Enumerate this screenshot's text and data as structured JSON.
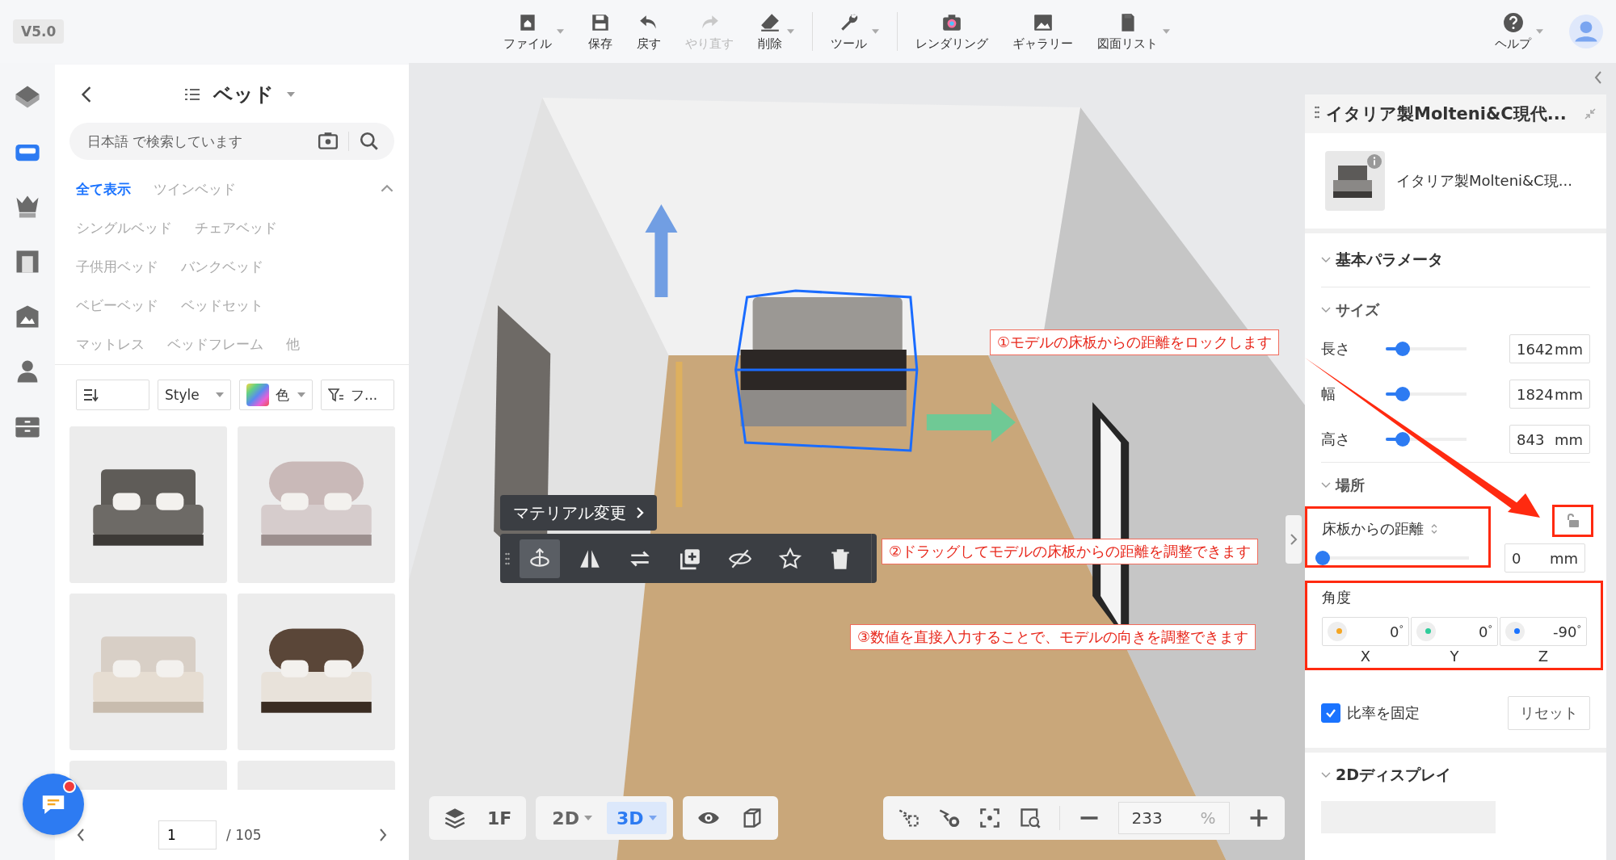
{
  "version": "V5.0",
  "toolbar_groups": [
    [
      {
        "label": "ファイル",
        "dropdown": true,
        "disabled": false
      },
      {
        "label": "保存",
        "dropdown": false,
        "disabled": false
      },
      {
        "label": "戻す",
        "dropdown": false,
        "disabled": false
      },
      {
        "label": "やり直す",
        "dropdown": false,
        "disabled": true
      },
      {
        "label": "削除",
        "dropdown": true,
        "disabled": false
      }
    ],
    [
      {
        "label": "ツール",
        "dropdown": true,
        "disabled": false
      }
    ],
    [
      {
        "label": "レンダリング",
        "dropdown": false,
        "disabled": false
      },
      {
        "label": "ギャラリー",
        "dropdown": false,
        "disabled": false
      },
      {
        "label": "図面リスト",
        "dropdown": true,
        "disabled": false
      }
    ]
  ],
  "help": {
    "label": "ヘルプ",
    "dropdown": true
  },
  "rail": [
    {
      "selected": false
    },
    {
      "selected": true
    },
    {
      "selected": false
    },
    {
      "selected": false
    },
    {
      "selected": false
    },
    {
      "selected": false
    },
    {
      "selected": false
    }
  ],
  "chat": {
    "unread": true
  },
  "catalog": {
    "title": "ベッド",
    "search": {
      "placeholder": "日本語 で検索しています"
    },
    "expanded": true,
    "categories": [
      {
        "label": "全て表示",
        "selected": true
      },
      {
        "label": "ツインベッド",
        "selected": false
      },
      {
        "label": "シングルベッド",
        "selected": false
      },
      {
        "label": "チェアベッド",
        "selected": false
      },
      {
        "label": "子供用ベッド",
        "selected": false
      },
      {
        "label": "バンクベッド",
        "selected": false
      },
      {
        "label": "ベビーベッド",
        "selected": false
      },
      {
        "label": "ベッドセット",
        "selected": false
      },
      {
        "label": "マットレス",
        "selected": false
      },
      {
        "label": "ベッドフレーム",
        "selected": false
      },
      {
        "label": "他",
        "selected": false
      }
    ],
    "filters": [
      {
        "kind": "sort"
      },
      {
        "kind": "select",
        "label": "Style"
      },
      {
        "kind": "color",
        "label": "色"
      },
      {
        "kind": "filter",
        "label": "フ..."
      }
    ],
    "pagination": {
      "page": "1",
      "total": "/ 105"
    }
  },
  "viewport": {
    "material_button": "マテリアル変更",
    "object_tools": [
      {
        "selected": true
      },
      {
        "selected": false
      },
      {
        "selected": false
      },
      {
        "selected": false
      },
      {
        "selected": false
      },
      {
        "selected": false
      },
      {
        "selected": false
      }
    ],
    "annotations": [
      "①モデルの床板からの距離をロックします",
      "②ドラッグしてモデルの床板からの距離を調整できます",
      "③数値を直接入力することで、モデルの向きを調整できます"
    ],
    "floor": "1F",
    "modes": [
      {
        "label": "2D",
        "selected": false
      },
      {
        "label": "3D",
        "selected": true
      }
    ],
    "zoom": {
      "value": "233",
      "unit": "%"
    }
  },
  "properties": {
    "title": "イタリア製Molteni&C現代...",
    "product_name": "イタリア製Molteni&C現...",
    "section": "基本パラメータ",
    "size_heading": "サイズ",
    "size": [
      {
        "label": "長さ",
        "value": "1642",
        "unit": "mm",
        "level": 0.15
      },
      {
        "label": "幅",
        "value": "1824",
        "unit": "mm",
        "level": 0.15
      },
      {
        "label": "高さ",
        "value": "843",
        "unit": "mm",
        "level": 0.15
      }
    ],
    "location_heading": "場所",
    "distance": {
      "label": "床板からの距離",
      "value": "0",
      "unit": "mm",
      "level": 0,
      "locked": false
    },
    "angle": {
      "label": "角度",
      "axes": [
        {
          "label": "X",
          "value": "0",
          "unit": "°",
          "color": "#f5a623"
        },
        {
          "label": "Y",
          "value": "0",
          "unit": "°",
          "color": "#2ecc9a"
        },
        {
          "label": "Z",
          "value": "-90",
          "unit": "°",
          "color": "#1a73ff"
        }
      ]
    },
    "lock_ratio": {
      "label": "比率を固定",
      "checked": true
    },
    "reset": "リセット",
    "display_heading": "2Dディスプレイ"
  }
}
